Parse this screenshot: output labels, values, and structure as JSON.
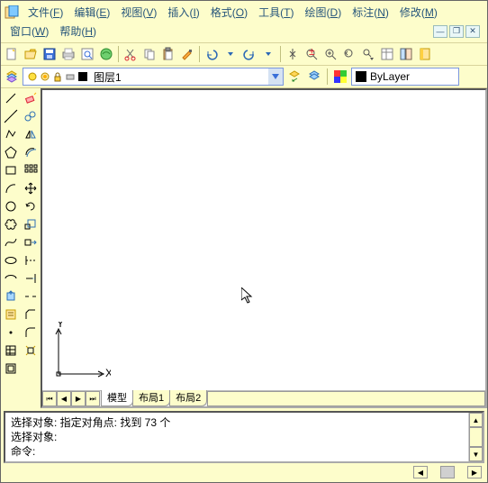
{
  "menu": {
    "file": {
      "label": "文件",
      "accel": "F"
    },
    "edit": {
      "label": "编辑",
      "accel": "E"
    },
    "view": {
      "label": "视图",
      "accel": "V"
    },
    "insert": {
      "label": "插入",
      "accel": "I"
    },
    "format": {
      "label": "格式",
      "accel": "O"
    },
    "tools": {
      "label": "工具",
      "accel": "T"
    },
    "draw": {
      "label": "绘图",
      "accel": "D"
    },
    "dimension": {
      "label": "标注",
      "accel": "N"
    },
    "modify": {
      "label": "修改",
      "accel": "M"
    },
    "window": {
      "label": "窗口",
      "accel": "W"
    },
    "help": {
      "label": "帮助",
      "accel": "H"
    }
  },
  "layer": {
    "current": "图层1"
  },
  "linetype": {
    "current": "ByLayer"
  },
  "ucs": {
    "x": "X",
    "y": "Y"
  },
  "tabs": {
    "model": "模型",
    "layout1": "布局1",
    "layout2": "布局2"
  },
  "command": {
    "line1": "选择对象: 指定对角点: 找到 73 个",
    "line2": "选择对象:",
    "prompt": "命令:"
  }
}
